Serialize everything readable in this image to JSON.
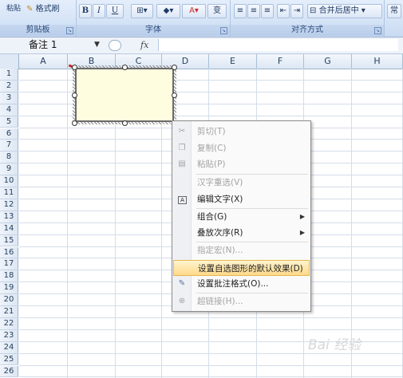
{
  "ribbon": {
    "format_painter": "格式刷",
    "clipboard_label": "剪贴板",
    "font_label": "字体",
    "alignment_label": "对齐方式",
    "bold": "B",
    "italic": "I",
    "underline": "U",
    "merge_center": "合并后居中",
    "top_left_fragment": "粘贴"
  },
  "formula_bar": {
    "name_box": "备注 1",
    "fx": "fx"
  },
  "columns": [
    "A",
    "B",
    "C",
    "D",
    "E",
    "F",
    "G",
    "H"
  ],
  "rows": [
    "1",
    "2",
    "3",
    "4",
    "5",
    "6",
    "7",
    "8",
    "9",
    "10",
    "11",
    "12",
    "13",
    "14",
    "15",
    "16",
    "17",
    "18",
    "19",
    "20",
    "21",
    "22",
    "23",
    "24",
    "25",
    "26"
  ],
  "context_menu": {
    "cut": "剪切(T)",
    "copy": "复制(C)",
    "paste": "粘贴(P)",
    "reconvert": "汉字重选(V)",
    "edit_text": "编辑文字(X)",
    "group": "组合(G)",
    "order": "叠放次序(R)",
    "assign_macro": "指定宏(N)...",
    "set_default": "设置自选图形的默认效果(D)",
    "format_comment": "设置批注格式(O)...",
    "hyperlink": "超链接(H)..."
  },
  "watermark": "Bai 经验"
}
